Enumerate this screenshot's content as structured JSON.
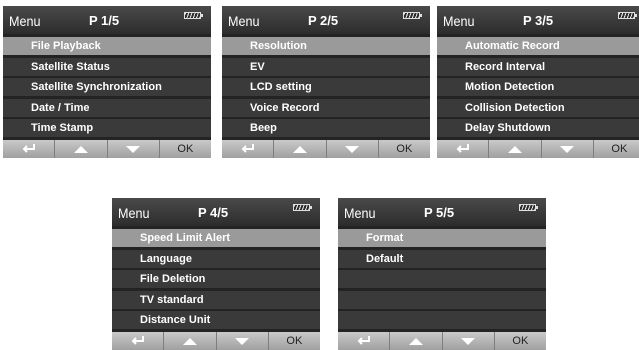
{
  "menu_label": "Menu",
  "ok_label": "OK",
  "icons": {
    "battery": "battery-icon",
    "back": "return-icon",
    "up": "up-arrow-icon",
    "down": "down-arrow-icon"
  },
  "colors": {
    "title_bar": "#333333",
    "item_bg": "#3a3a3a",
    "selected_bg": "#9a9a9a",
    "nav_bg": "#a8a8a8"
  },
  "screens": [
    {
      "page": "P 1/5",
      "items": [
        "File Playback",
        "Satellite Status",
        "Satellite Synchronization",
        "Date / Time",
        "Time Stamp"
      ]
    },
    {
      "page": "P 2/5",
      "items": [
        "Resolution",
        "EV",
        "LCD setting",
        "Voice Record",
        "Beep"
      ]
    },
    {
      "page": "P 3/5",
      "items": [
        "Automatic Record",
        "Record Interval",
        "Motion Detection",
        "Collision Detection",
        "Delay Shutdown"
      ]
    },
    {
      "page": "P 4/5",
      "items": [
        "Speed Limit Alert",
        "Language",
        "File Deletion",
        "TV standard",
        "Distance Unit"
      ]
    },
    {
      "page": "P 5/5",
      "items": [
        "Format",
        "Default",
        "",
        "",
        ""
      ]
    }
  ]
}
